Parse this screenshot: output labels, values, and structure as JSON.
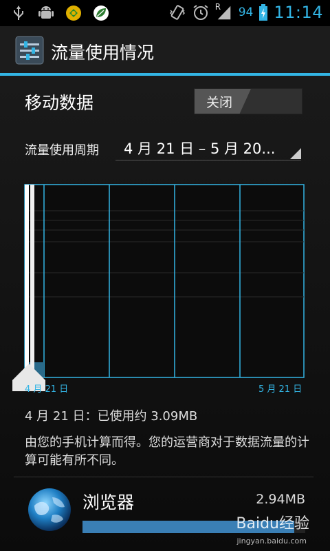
{
  "status_bar": {
    "icons": [
      "usb-icon",
      "android-debug-icon",
      "app-notification-icon",
      "leaf-app-icon",
      "vibrate-icon",
      "alarm-icon",
      "signal-icon",
      "battery-icon"
    ],
    "signal_type": "R",
    "battery_percent": "94",
    "time": "11:14"
  },
  "action_bar": {
    "title": "流量使用情况",
    "icon": "sliders-settings-icon"
  },
  "mobile_data": {
    "label": "移动数据",
    "toggle_label": "关闭"
  },
  "cycle": {
    "label": "流量使用周期",
    "value": "4 月 21 日 – 5 月 20..."
  },
  "chart": {
    "start_tick": "4 月 21 日",
    "end_tick": "5 月 21 日",
    "accent": "#33b5e5"
  },
  "summary": {
    "usage": "4 月 21 日：已使用约 3.09MB",
    "note": "由您的手机计算而得。您的运营商对于数据流量的计算可能有所不同。"
  },
  "apps": [
    {
      "name": "浏览器",
      "size": "2.94MB",
      "share": 0.95,
      "icon": "globe-icon"
    }
  ],
  "watermark": {
    "text": "Baidu经验",
    "sub": "jingyan.baidu.com"
  }
}
